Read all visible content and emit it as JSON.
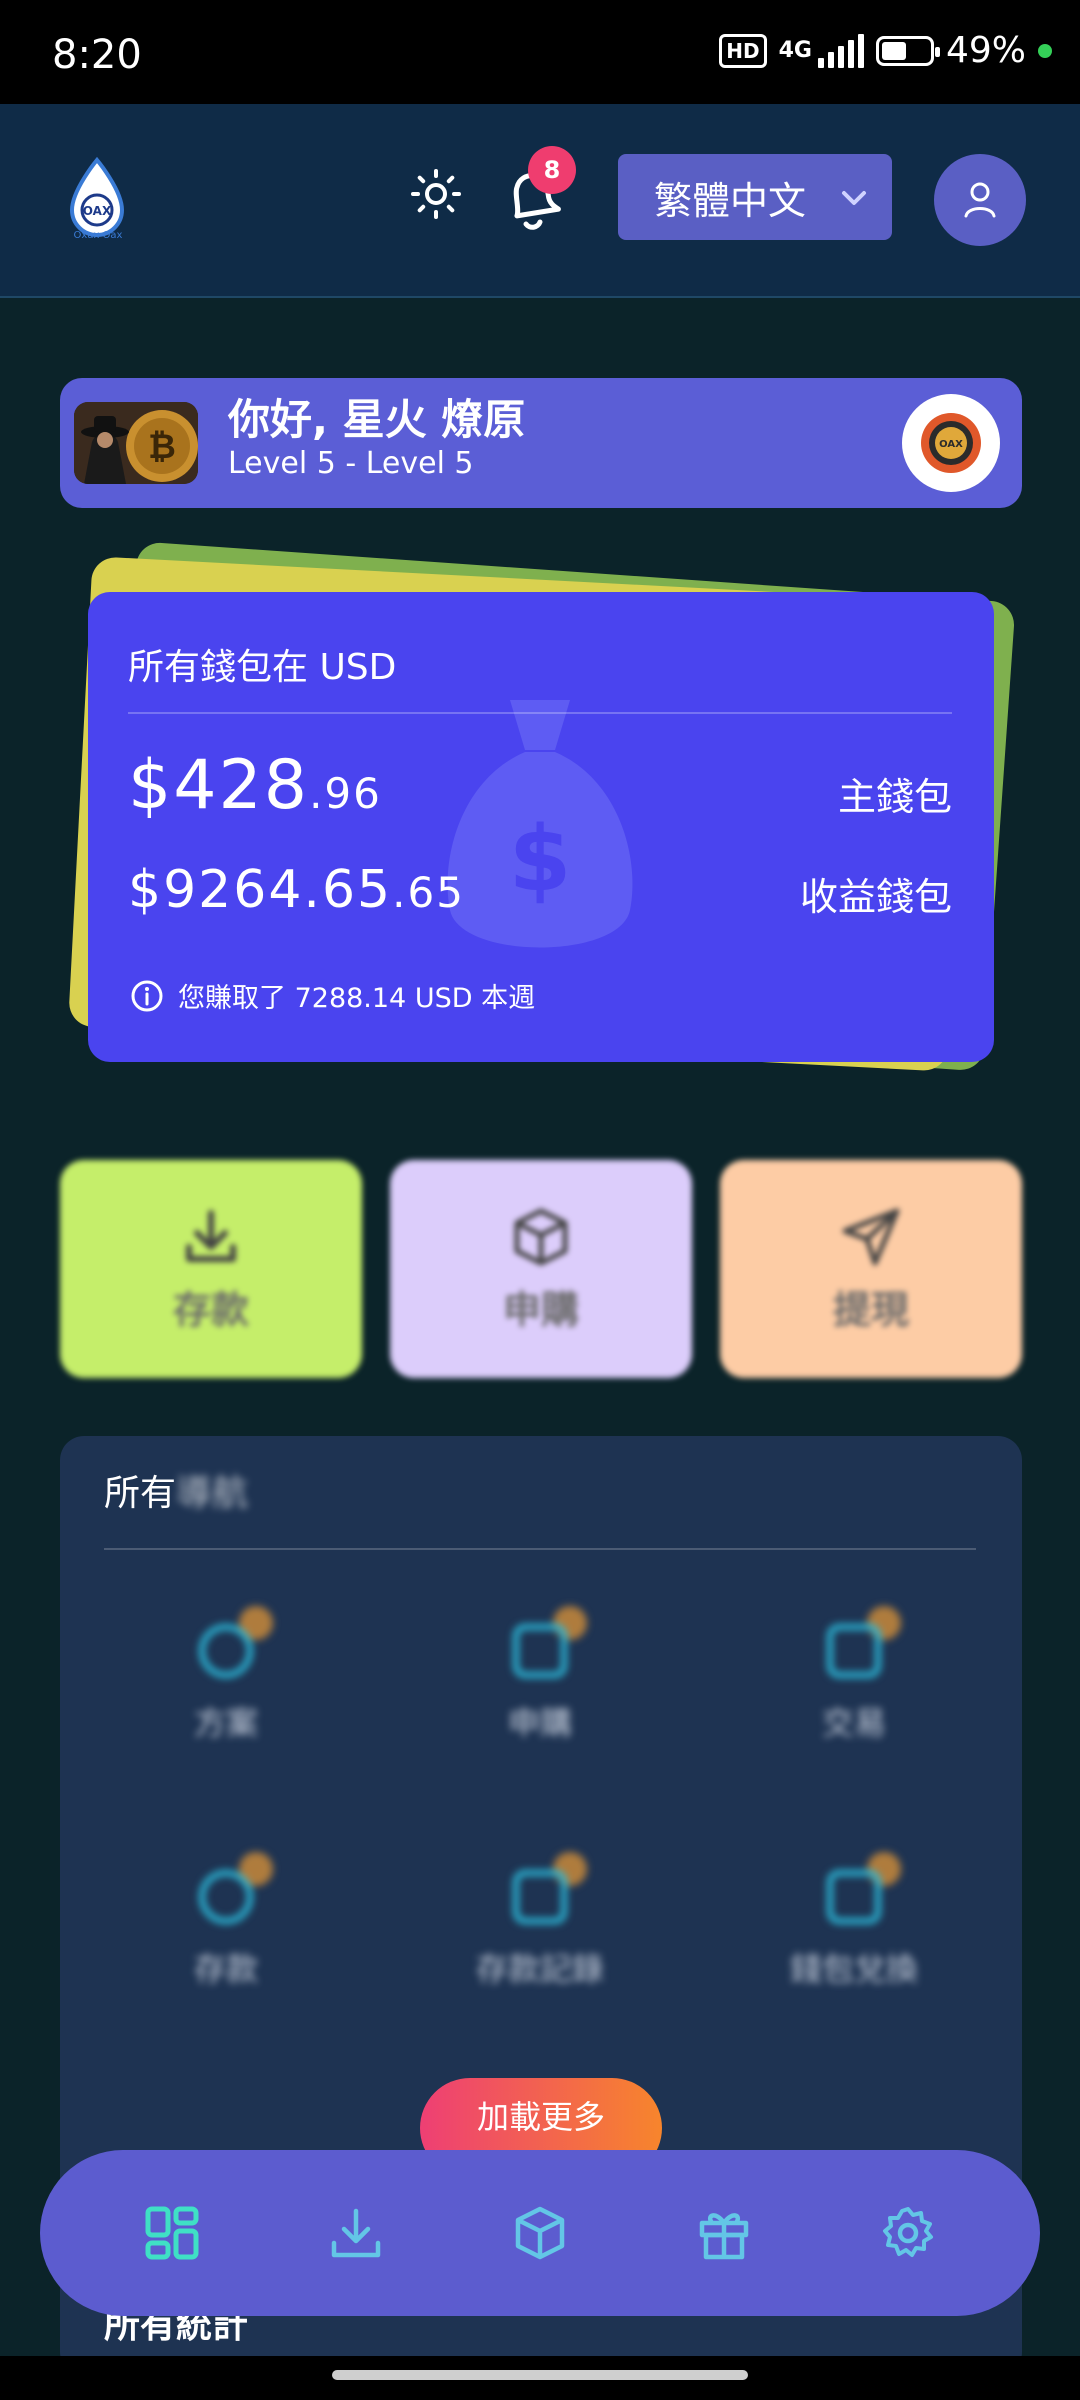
{
  "status_bar": {
    "time": "8:20",
    "hd": "HD",
    "network": "4G",
    "battery": "49%",
    "battery_level": 0.49
  },
  "header": {
    "logo_text": "Oxax Oax",
    "notification_count": "8",
    "language": "繁體中文"
  },
  "greeting": {
    "name": "你好, 星火 燎原",
    "level": "Level 5 - Level 5"
  },
  "wallet": {
    "title": "所有錢包在 USD",
    "main_amount": "$428",
    "main_cents": ".96",
    "main_label": "主錢包",
    "earn_amount": "$9264.65",
    "earn_cents": ".65",
    "earn_label": "收益錢包",
    "info": "您賺取了 7288.14 USD 本週"
  },
  "actions": [
    {
      "label": "存款",
      "icon": "download-icon"
    },
    {
      "label": "申購",
      "icon": "box-icon"
    },
    {
      "label": "提現",
      "icon": "send-icon"
    }
  ],
  "nav_section": {
    "title_a": "所有",
    "title_b": "導航",
    "items": [
      {
        "label": "方案",
        "icon": "eye-icon"
      },
      {
        "label": "申購",
        "icon": "card-icon"
      },
      {
        "label": "交易",
        "icon": "document-icon"
      },
      {
        "label": "存款",
        "icon": "dollar-icon"
      },
      {
        "label": "存款記錄",
        "icon": "monitor-icon"
      },
      {
        "label": "錢包兌換",
        "icon": "exchange-icon"
      }
    ],
    "load_more": "加載更多"
  },
  "stats_title": "所有統計",
  "bottom_nav": [
    "dashboard-icon",
    "download-icon",
    "box-icon",
    "gift-icon",
    "settings-icon"
  ],
  "colors": {
    "background": "#0b2329",
    "accent": "#5c5ccf",
    "wallet_card": "#4a44ef"
  }
}
